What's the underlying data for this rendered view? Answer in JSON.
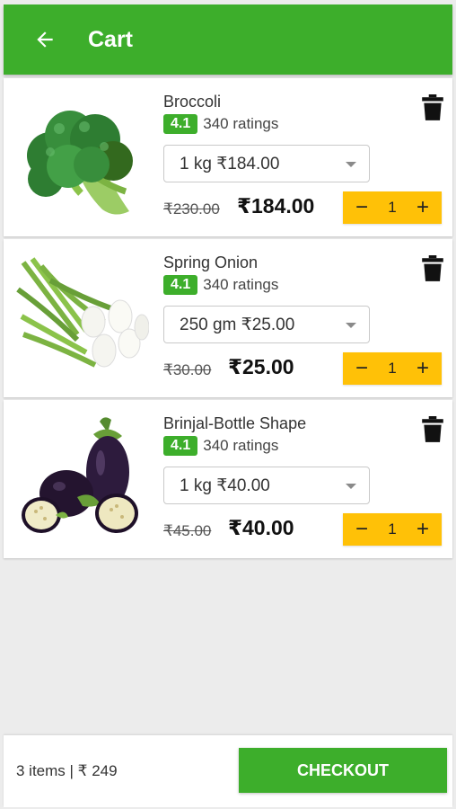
{
  "header": {
    "title": "Cart",
    "back_icon": "arrow-back-icon",
    "color": "#3dae2b"
  },
  "items": [
    {
      "name": "Broccoli",
      "rating": "4.1",
      "ratings_count": "340 ratings",
      "variant": "1 kg ₹184.00",
      "mrp": "₹230.00",
      "price": "₹184.00",
      "quantity": "1",
      "image_icon": "broccoli-image"
    },
    {
      "name": "Spring Onion",
      "rating": "4.1",
      "ratings_count": "340 ratings",
      "variant": "250 gm ₹25.00",
      "mrp": "₹30.00",
      "price": "₹25.00",
      "quantity": "1",
      "image_icon": "spring-onion-image"
    },
    {
      "name": "Brinjal-Bottle Shape",
      "rating": "4.1",
      "ratings_count": "340 ratings",
      "variant": "1 kg ₹40.00",
      "mrp": "₹45.00",
      "price": "₹40.00",
      "quantity": "1",
      "image_icon": "brinjal-image"
    }
  ],
  "qty_controls": {
    "minus": "−",
    "plus": "+",
    "color": "#ffc107"
  },
  "footer": {
    "summary": "3 items | ₹ 249",
    "checkout_label": "CHECKOUT"
  }
}
